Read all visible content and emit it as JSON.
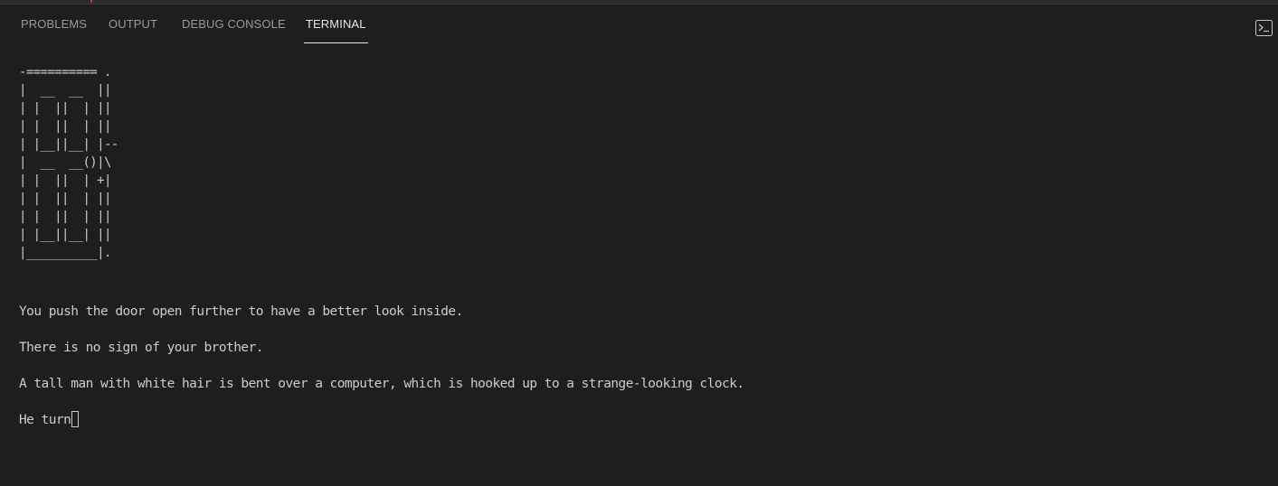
{
  "panel": {
    "tabs": [
      {
        "label": "PROBLEMS",
        "active": false
      },
      {
        "label": "OUTPUT",
        "active": false
      },
      {
        "label": "DEBUG CONSOLE",
        "active": false
      },
      {
        "label": "TERMINAL",
        "active": true
      }
    ],
    "actions": {
      "terminal_icon": "terminal-icon"
    }
  },
  "terminal": {
    "ascii_art": "-========== .\n|  __  __  ||\n| |  ||  | ||\n| |  ||  | ||\n| |__||__| |--\n|  __  __()|\\\n| |  ||  | +|\n| |  ||  | ||\n| |  ||  | ||\n| |__||__| ||\n|__________|.",
    "lines": [
      "You push the door open further to have a better look inside.",
      "There is no sign of your brother.",
      "A tall man with white hair is bent over a computer, which is hooked up to a strange-looking clock.",
      "He turn"
    ]
  },
  "colors": {
    "background": "#1e1e1e",
    "text": "#cccccc",
    "tab_inactive": "#9a9a9a",
    "tab_active": "#e7e7e7"
  }
}
